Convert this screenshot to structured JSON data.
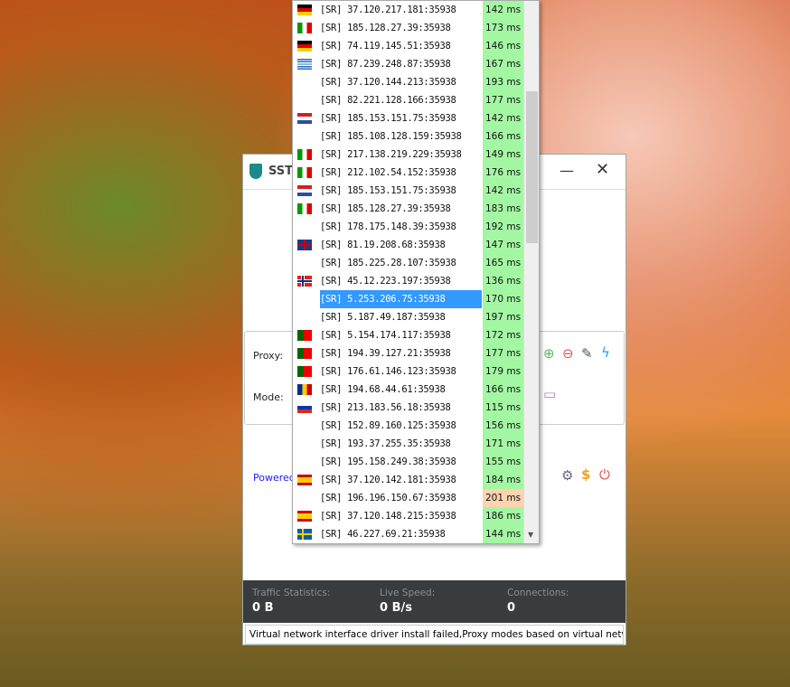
{
  "window": {
    "title": "SSTa",
    "minimize": "—",
    "close": "✕"
  },
  "labels": {
    "proxy": "Proxy:",
    "mode": "Mode:",
    "powered": "Powered"
  },
  "icons": {
    "add": "add-icon",
    "remove": "remove-icon",
    "edit": "edit-icon",
    "test": "lightning-icon",
    "folder": "folder-icon",
    "settings": "gear-icon",
    "donate": "dollar-icon",
    "power": "power-icon"
  },
  "footer": {
    "traffic_label": "Traffic Statistics:",
    "traffic": "0 B",
    "speed_label": "Live Speed:",
    "speed": "0 B/s",
    "conn_label": "Connections:",
    "conn": "0"
  },
  "status": "Virtual network interface driver install failed,Proxy modes based on virtual network card",
  "colors": {
    "latency_ok": "#a3f7a3",
    "latency_warn": "#fdd3b0",
    "selected": "#3399ff"
  },
  "servers": [
    {
      "flag": "de",
      "addr": "[SR] 37.120.217.181:35938",
      "ms": "142 ms"
    },
    {
      "flag": "it",
      "addr": "[SR] 185.128.27.39:35938",
      "ms": "173 ms"
    },
    {
      "flag": "de",
      "addr": "[SR] 74.119.145.51:35938",
      "ms": "146 ms"
    },
    {
      "flag": "gr",
      "addr": "[SR] 87.239.248.87:35938",
      "ms": "167 ms"
    },
    {
      "flag": "",
      "addr": "[SR] 37.120.144.213:35938",
      "ms": "193 ms"
    },
    {
      "flag": "",
      "addr": "[SR] 82.221.128.166:35938",
      "ms": "177 ms"
    },
    {
      "flag": "nl",
      "addr": "[SR] 185.153.151.75:35938",
      "ms": "142 ms"
    },
    {
      "flag": "",
      "addr": "[SR] 185.108.128.159:35938",
      "ms": "166 ms"
    },
    {
      "flag": "it",
      "addr": "[SR] 217.138.219.229:35938",
      "ms": "149 ms"
    },
    {
      "flag": "it",
      "addr": "[SR] 212.102.54.152:35938",
      "ms": "176 ms"
    },
    {
      "flag": "nl",
      "addr": "[SR] 185.153.151.75:35938",
      "ms": "142 ms"
    },
    {
      "flag": "it",
      "addr": "[SR] 185.128.27.39:35938",
      "ms": "183 ms"
    },
    {
      "flag": "",
      "addr": "[SR] 178.175.148.39:35938",
      "ms": "192 ms"
    },
    {
      "flag": "gb",
      "addr": "[SR] 81.19.208.68:35938",
      "ms": "147 ms"
    },
    {
      "flag": "",
      "addr": "[SR] 185.225.28.107:35938",
      "ms": "165 ms"
    },
    {
      "flag": "no",
      "addr": "[SR] 45.12.223.197:35938",
      "ms": "136 ms"
    },
    {
      "flag": "",
      "addr": "[SR] 5.253.206.75:35938",
      "ms": "170 ms",
      "selected": true
    },
    {
      "flag": "",
      "addr": "[SR] 5.187.49.187:35938",
      "ms": "197 ms"
    },
    {
      "flag": "pt",
      "addr": "[SR] 5.154.174.117:35938",
      "ms": "172 ms"
    },
    {
      "flag": "pt",
      "addr": "[SR] 194.39.127.21:35938",
      "ms": "177 ms"
    },
    {
      "flag": "pt",
      "addr": "[SR] 176.61.146.123:35938",
      "ms": "179 ms"
    },
    {
      "flag": "ro",
      "addr": "[SR] 194.68.44.61:35938",
      "ms": "166 ms"
    },
    {
      "flag": "ru",
      "addr": "[SR] 213.183.56.18:35938",
      "ms": "115 ms"
    },
    {
      "flag": "",
      "addr": "[SR] 152.89.160.125:35938",
      "ms": "156 ms"
    },
    {
      "flag": "",
      "addr": "[SR] 193.37.255.35:35938",
      "ms": "171 ms"
    },
    {
      "flag": "",
      "addr": "[SR] 195.158.249.38:35938",
      "ms": "155 ms"
    },
    {
      "flag": "es",
      "addr": "[SR] 37.120.142.181:35938",
      "ms": "184 ms"
    },
    {
      "flag": "",
      "addr": "[SR] 196.196.150.67:35938",
      "ms": "201 ms",
      "warn": true
    },
    {
      "flag": "es",
      "addr": "[SR] 37.120.148.215:35938",
      "ms": "186 ms"
    },
    {
      "flag": "se",
      "addr": "[SR] 46.227.69.21:35938",
      "ms": "144 ms"
    }
  ]
}
